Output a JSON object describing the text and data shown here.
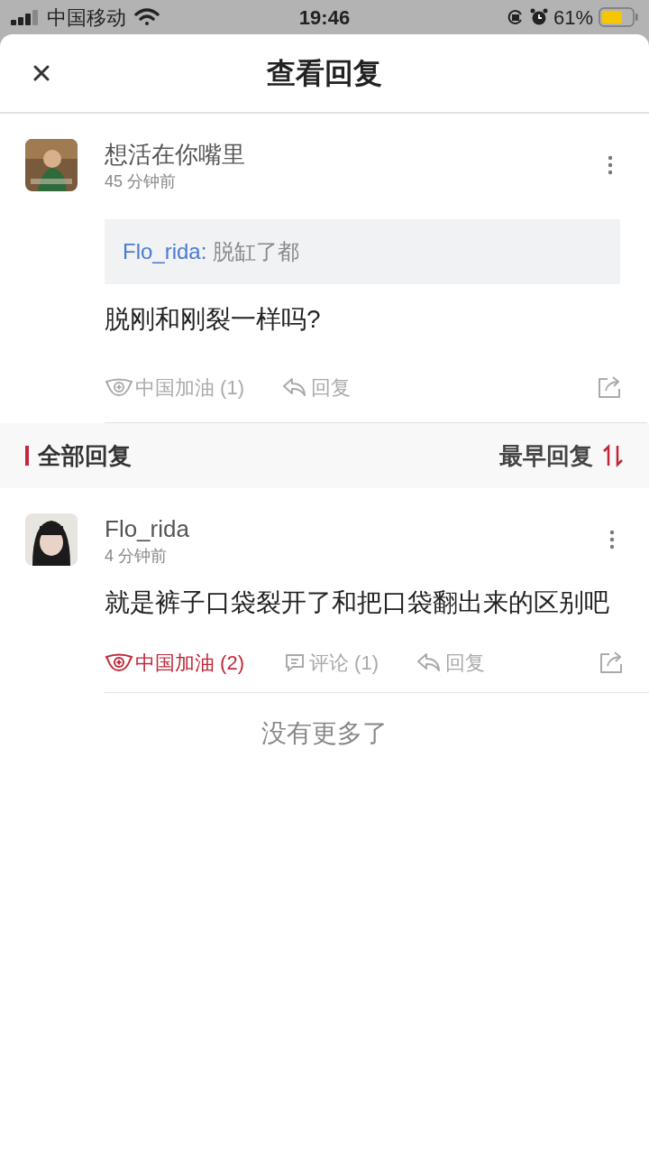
{
  "status_bar": {
    "carrier": "中国移动",
    "time": "19:46",
    "battery": "61%"
  },
  "header": {
    "title": "查看回复"
  },
  "comment": {
    "author": "想活在你嘴里",
    "time": "45 分钟前",
    "quote": {
      "author": "Flo_rida:",
      "text": "脱缸了都"
    },
    "text": "脱刚和刚裂一样吗?",
    "cheer": {
      "label": "中国加油 (1)",
      "active": false
    },
    "reply": "回复"
  },
  "section": {
    "title": "全部回复",
    "sort": "最早回复"
  },
  "replies": [
    {
      "author": "Flo_rida",
      "time": "4 分钟前",
      "text": "就是裤子口袋裂开了和把口袋翻出来的区别吧",
      "cheer": {
        "label": "中国加油 (2)",
        "active": true
      },
      "comments": "评论 (1)",
      "reply": "回复"
    }
  ],
  "footer": "没有更多了"
}
